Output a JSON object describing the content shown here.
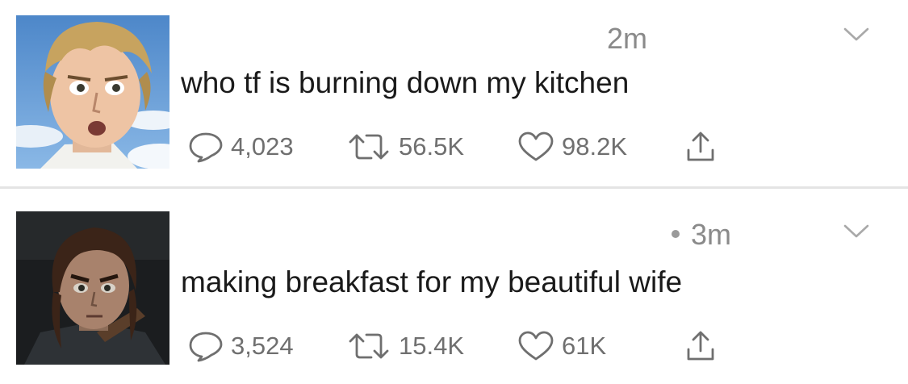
{
  "tweets": [
    {
      "timestamp": "2m",
      "text": "who tf is burning down my kitchen",
      "replies": "4,023",
      "retweets": "56.5K",
      "likes": "98.2K",
      "avatar_icon": "avatar-blond-man"
    },
    {
      "timestamp": "3m",
      "text": "making breakfast for my beautiful wife",
      "replies": "3,524",
      "retweets": "15.4K",
      "likes": "61K",
      "avatar_icon": "avatar-dark-haired-woman"
    }
  ],
  "icons": {
    "reply": "reply-icon",
    "retweet": "retweet-icon",
    "like": "heart-icon",
    "share": "share-icon",
    "menu": "chevron-down-icon"
  },
  "colors": {
    "text": "#1a1a1a",
    "muted": "#6f6f6f",
    "timestamp": "#8a8a8a",
    "divider": "#e4e4e4"
  }
}
